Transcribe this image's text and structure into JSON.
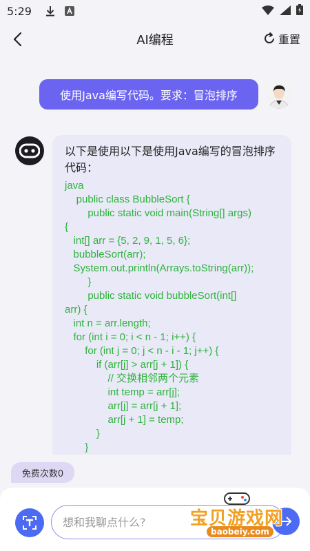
{
  "status_bar": {
    "time": "5:29"
  },
  "header": {
    "title": "AI编程",
    "reset_label": "重置"
  },
  "chat": {
    "user_message": "使用Java编写代码。要求：冒泡排序",
    "bot_intro": "以下是使用以下是使用Java编写的冒泡排序代码：",
    "code_lines": [
      "java",
      "    public class BubbleSort {",
      "        public static void main(String[] args)",
      "{",
      "   int[] arr = {5, 2, 9, 1, 5, 6};",
      "   bubbleSort(arr);",
      "   System.out.println(Arrays.toString(arr));",
      "        }",
      "        public static void bubbleSort(int[]",
      "arr) {",
      "   int n = arr.length;",
      "   for (int i = 0; i < n - 1; i++) {",
      "       for (int j = 0; j < n - i - 1; j++) {",
      "           if (arr[j] > arr[j + 1]) {",
      "               // 交换相邻两个元素",
      "               int temp = arr[j];",
      "               arr[j] = arr[j + 1];",
      "               arr[j + 1] = temp;",
      "           }",
      "       }"
    ]
  },
  "free_count_label": "免费次数0",
  "input": {
    "placeholder": "想和我聊点什么?",
    "value": ""
  },
  "watermark": {
    "title": "宝贝游戏网",
    "url": "baobeiy.com"
  },
  "colors": {
    "accent": "#6b64f0",
    "code": "#2db33a",
    "button": "#4c6bf2"
  }
}
